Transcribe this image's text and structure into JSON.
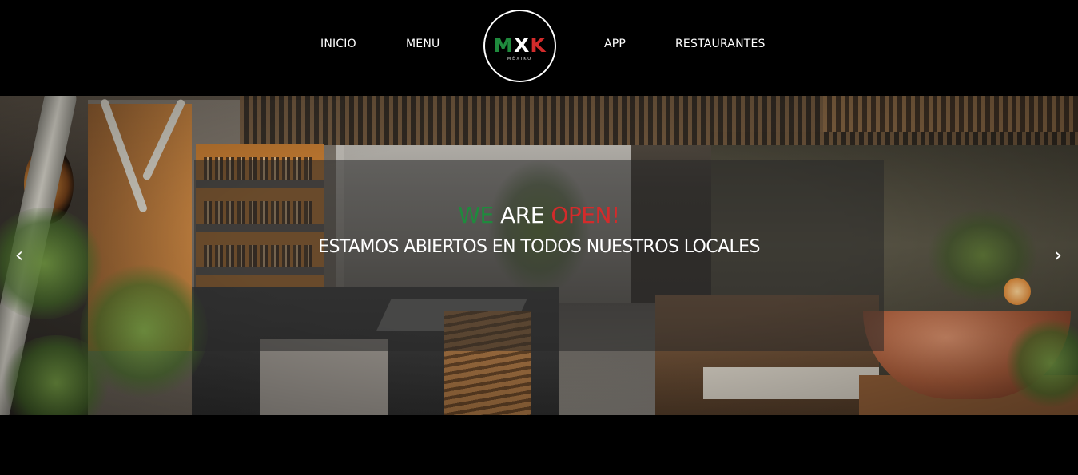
{
  "nav": {
    "items": [
      {
        "label": "INICIO"
      },
      {
        "label": "MENU"
      },
      {
        "label": "APP"
      },
      {
        "label": "RESTAURANTES"
      }
    ]
  },
  "logo": {
    "letters": [
      "M",
      "X",
      "K"
    ],
    "subtitle": "MÉXIKO",
    "colors": [
      "#1f8a3d",
      "#ffffff",
      "#d32b2b"
    ]
  },
  "hero": {
    "headline_words": [
      "WE",
      "ARE",
      "OPEN!"
    ],
    "subheadline": "ESTAMOS ABIERTOS EN TODOS NUESTROS LOCALES",
    "prev_arrow": "‹",
    "next_arrow": "›"
  },
  "colors": {
    "background": "#000000",
    "mexico_green": "#1f8a3d",
    "mexico_red": "#d32b2b",
    "text": "#ffffff"
  }
}
